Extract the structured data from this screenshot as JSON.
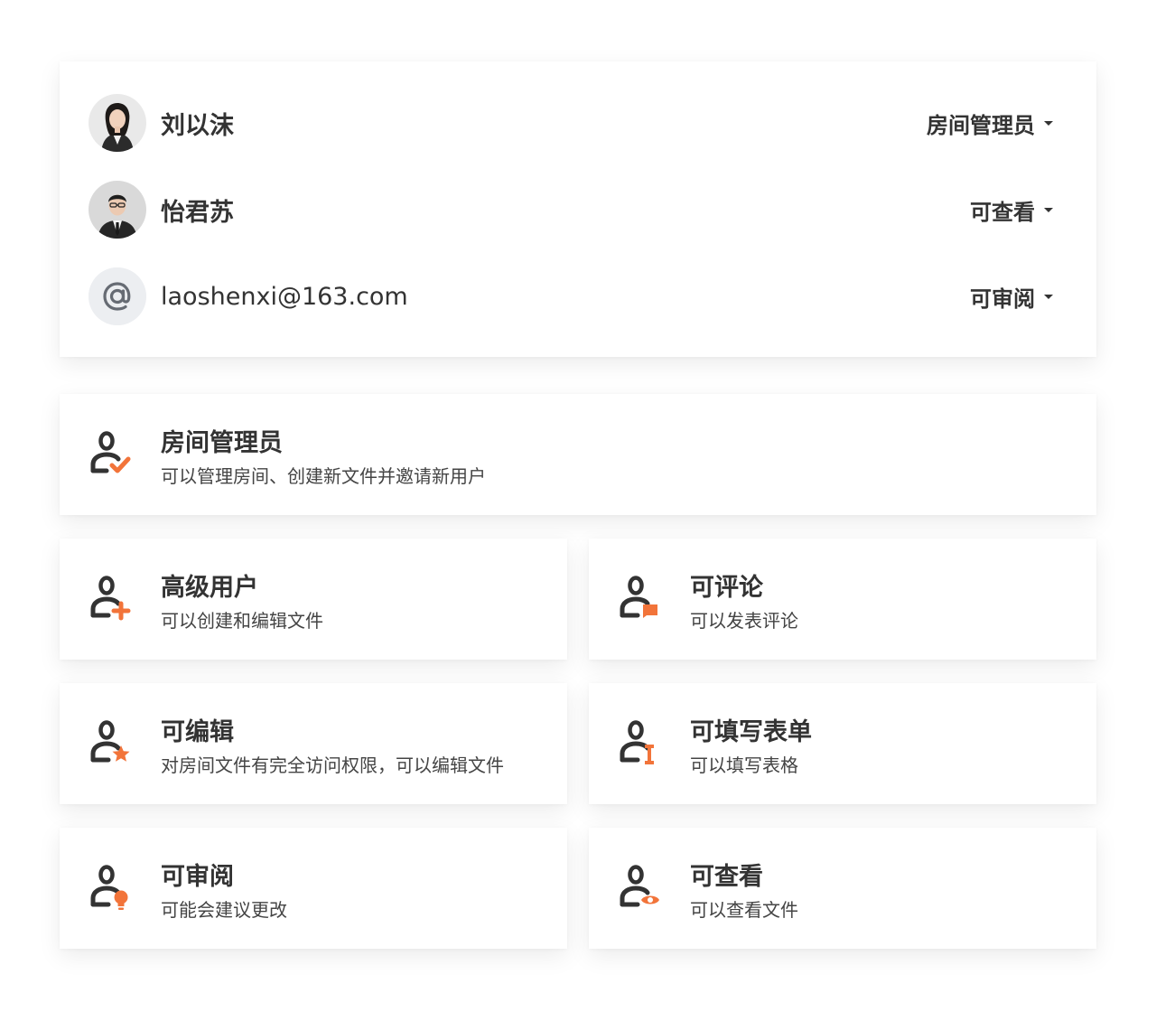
{
  "members": [
    {
      "name": "刘以沫",
      "role": "房间管理员",
      "avatar": "woman-photo-avatar"
    },
    {
      "name": "怡君苏",
      "role": "可查看",
      "avatar": "man-photo-avatar"
    },
    {
      "name": "laoshenxi@163.com",
      "role": "可审阅",
      "avatar": "at-sign-icon"
    }
  ],
  "roles": {
    "room_admin": {
      "title": "房间管理员",
      "desc": "可以管理房间、创建新文件并邀请新用户",
      "icon": "user-check-icon"
    },
    "power_user": {
      "title": "高级用户",
      "desc": "可以创建和编辑文件",
      "icon": "user-plus-icon"
    },
    "commenter": {
      "title": "可评论",
      "desc": "可以发表评论",
      "icon": "user-comment-icon"
    },
    "editor": {
      "title": "可编辑",
      "desc": "对房间文件有完全访问权限，可以编辑文件",
      "icon": "user-star-icon"
    },
    "form_filler": {
      "title": "可填写表单",
      "desc": "可以填写表格",
      "icon": "user-text-cursor-icon"
    },
    "reviewer": {
      "title": "可审阅",
      "desc": "可能会建议更改",
      "icon": "user-bulb-icon"
    },
    "viewer": {
      "title": "可查看",
      "desc": "可以查看文件",
      "icon": "user-eye-icon"
    }
  },
  "colors": {
    "accent": "#f2743a",
    "text": "#333333",
    "icon": "#333333"
  }
}
